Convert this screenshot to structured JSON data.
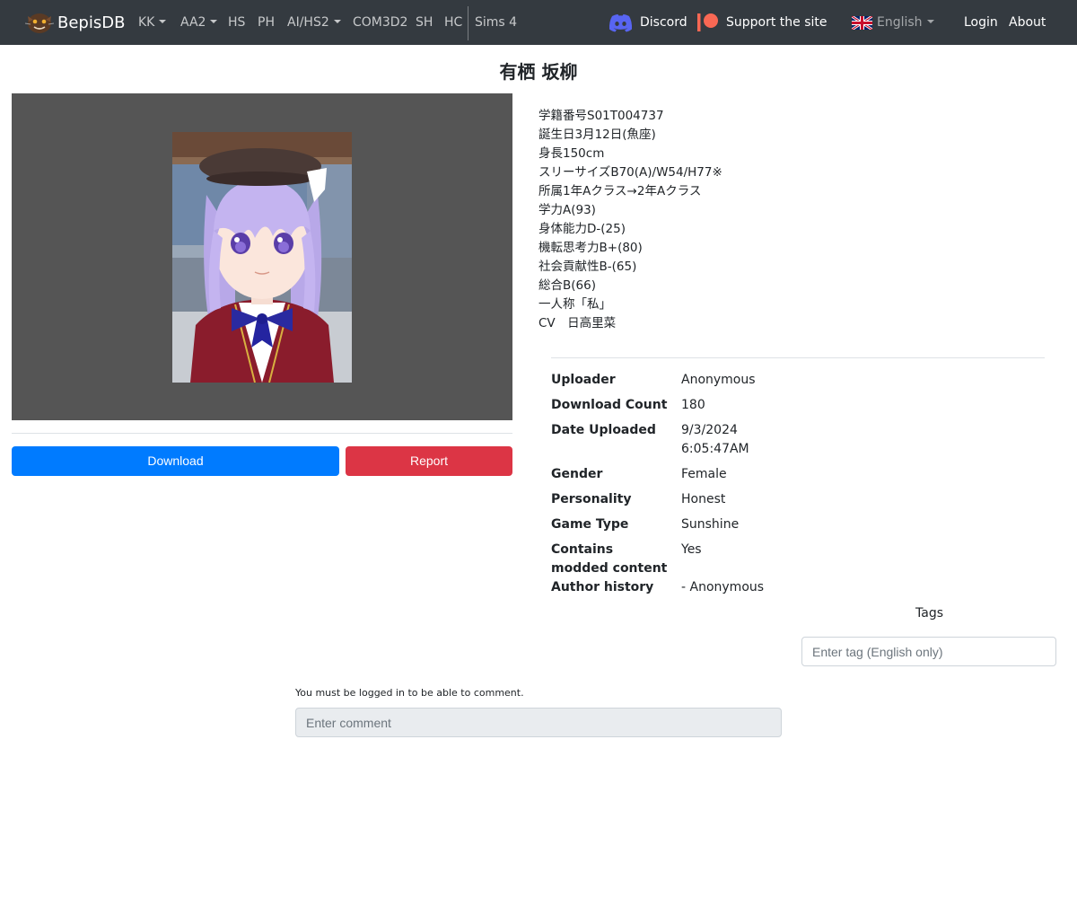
{
  "nav": {
    "brand": "BepisDB",
    "items": [
      {
        "label": "KK",
        "dropdown": true
      },
      {
        "label": "AA2",
        "dropdown": true
      },
      {
        "label": "HS",
        "dropdown": false
      },
      {
        "label": "PH",
        "dropdown": false
      },
      {
        "label": "AI/HS2",
        "dropdown": true
      },
      {
        "label": "COM3D2",
        "dropdown": false
      },
      {
        "label": "SH",
        "dropdown": false
      },
      {
        "label": "HC",
        "dropdown": false
      },
      {
        "label": "Sims 4",
        "dropdown": false
      }
    ],
    "discord": "Discord",
    "support": "Support the site",
    "language": "English",
    "login": "Login",
    "about": "About"
  },
  "card": {
    "title": "有栖 坂柳",
    "description": [
      "学籍番号S01T004737",
      "誕生日3月12日(魚座)",
      "身長150cm",
      "スリーサイズB70(A)/W54/H77※",
      "所属1年Aクラス→2年Aクラス",
      "学力A(93)",
      "身体能力D-(25)",
      "機転思考力B+(80)",
      "社会貢献性B-(65)",
      "総合B(66)",
      "一人称「私」",
      "CV　日高里菜"
    ],
    "download_label": "Download",
    "report_label": "Report"
  },
  "info": {
    "uploader": {
      "label": "Uploader",
      "value": "Anonymous"
    },
    "download_count": {
      "label": "Download Count",
      "value": "180"
    },
    "date_uploaded": {
      "label": "Date Uploaded",
      "date": "9/3/2024",
      "time": "6:05:47AM"
    },
    "gender": {
      "label": "Gender",
      "value": "Female"
    },
    "personality": {
      "label": "Personality",
      "value": "Honest"
    },
    "game_type": {
      "label": "Game Type",
      "value": "Sunshine"
    },
    "modded": {
      "label_line1": "Contains",
      "label_line2": "modded content",
      "value": "Yes"
    },
    "author_history": {
      "label": "Author history",
      "value": "- Anonymous"
    }
  },
  "tags": {
    "label": "Tags",
    "placeholder": "Enter tag (English only)"
  },
  "comments": {
    "note": "You must be logged in to be able to comment.",
    "placeholder": "Enter comment"
  },
  "colors": {
    "navbar": "#343a40",
    "primary": "#007bff",
    "danger": "#dc3545",
    "image_bg": "#555555"
  }
}
